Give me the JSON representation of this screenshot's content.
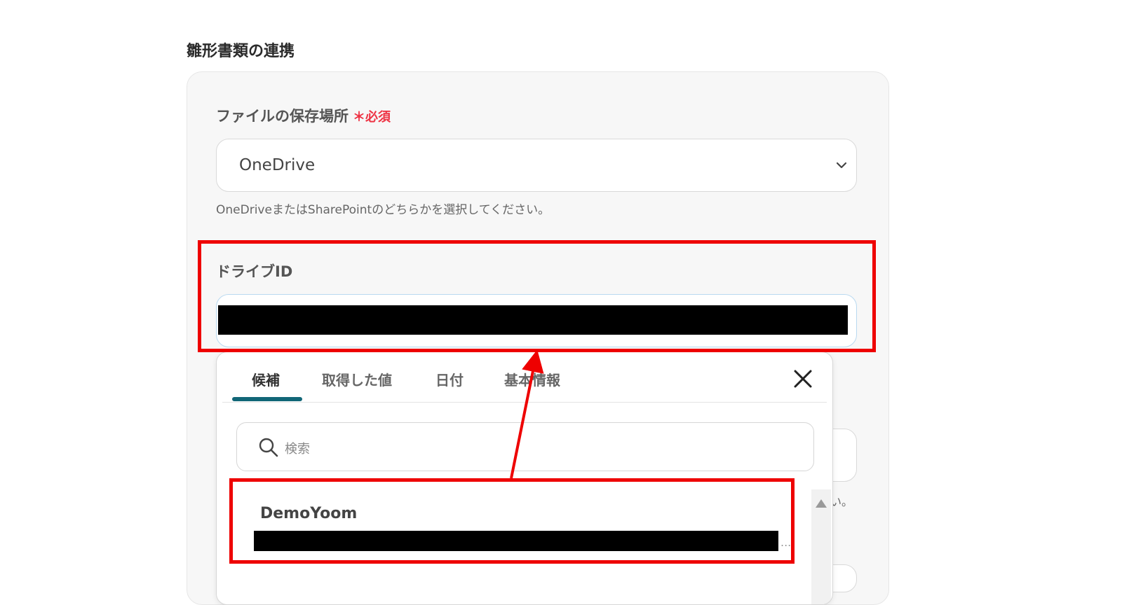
{
  "section": {
    "title": "雛形書類の連携"
  },
  "storage": {
    "label": "ファイルの保存場所",
    "required_mark": "＊",
    "required_text": "必須",
    "selected": "OneDrive",
    "hint": "OneDriveまたはSharePointのどちらかを選択してください。"
  },
  "drive": {
    "label": "ドライブID"
  },
  "picker": {
    "tabs": [
      "候補",
      "取得した値",
      "日付",
      "基本情報"
    ],
    "active_tab": "候補",
    "search_placeholder": "検索",
    "option_name": "DemoYoom",
    "ellipsis": "..."
  },
  "background": {
    "hint_fragment": "い。"
  },
  "colors": {
    "highlight": "#ee0000",
    "required": "#ee3344",
    "tab_accent": "#116677"
  },
  "icons": [
    "chevron-down-icon",
    "close-icon",
    "search-icon",
    "scroll-up-icon"
  ]
}
